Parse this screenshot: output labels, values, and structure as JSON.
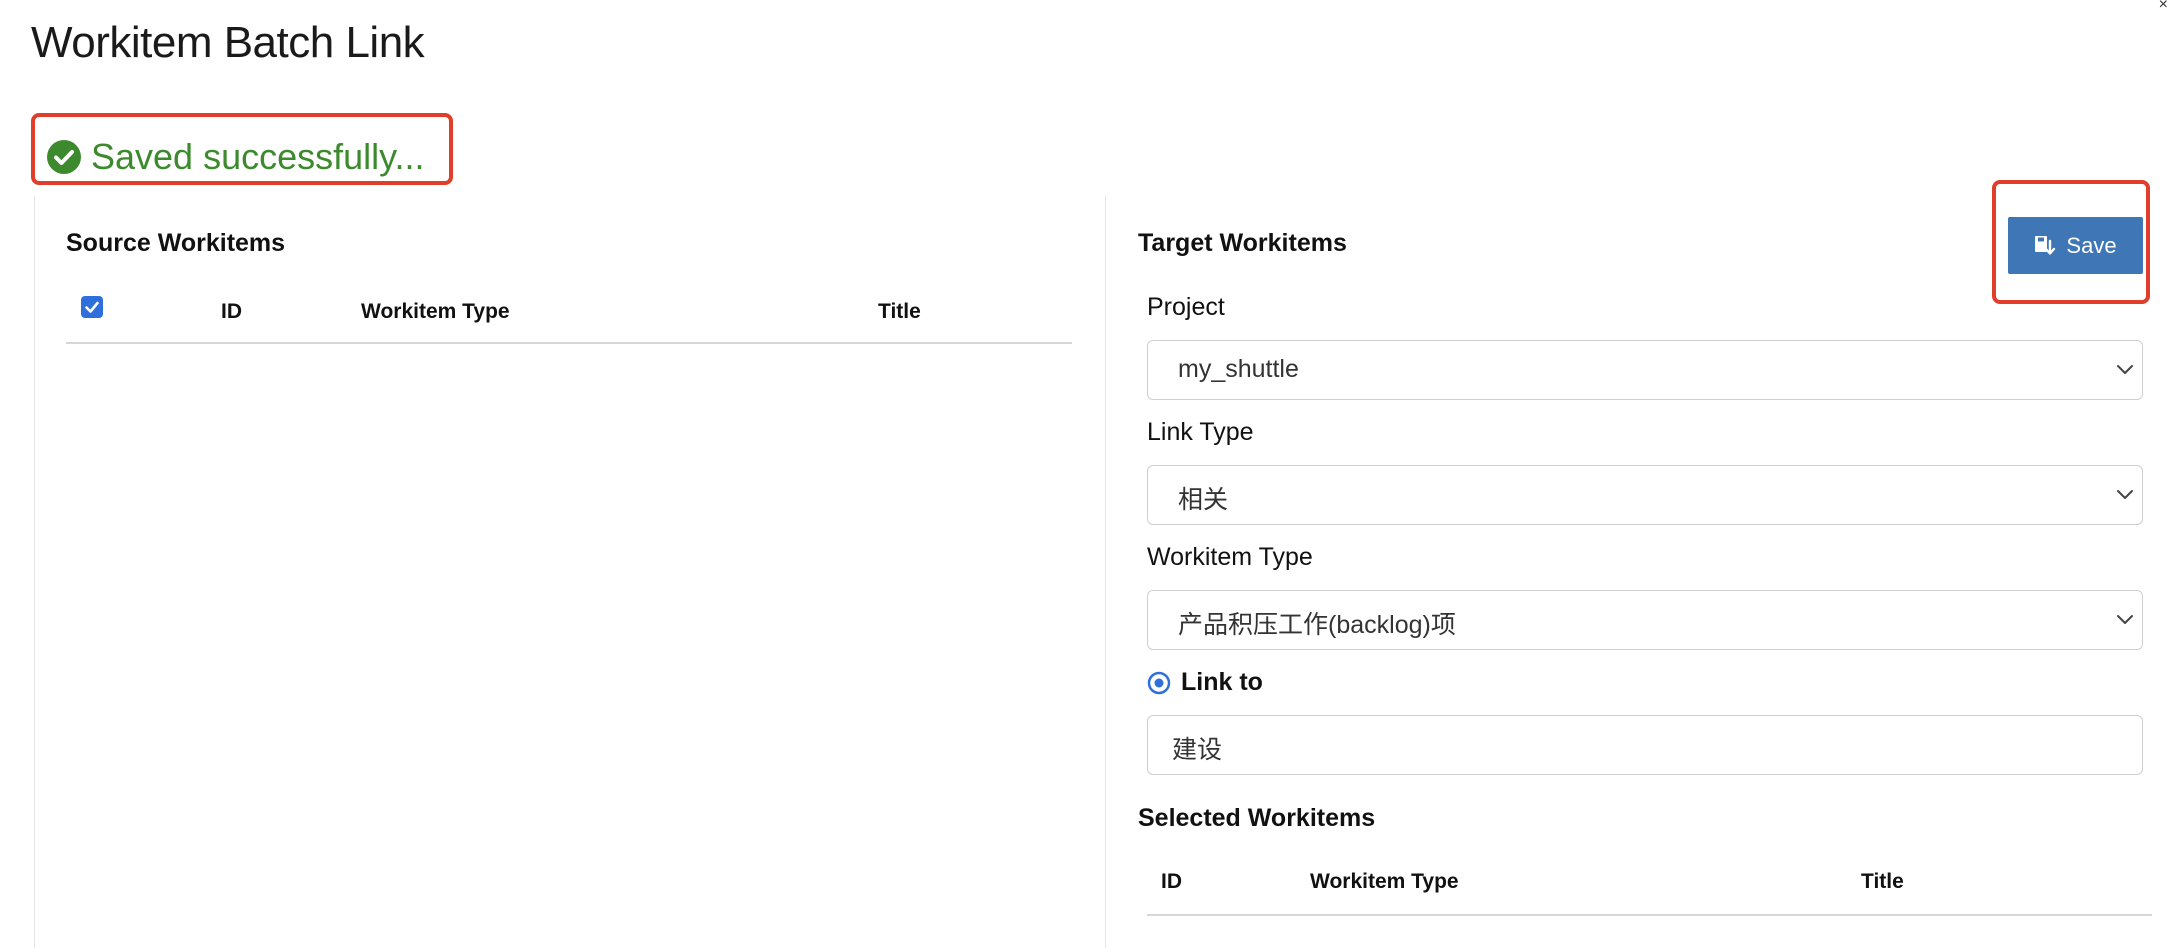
{
  "page": {
    "title": "Workitem Batch Link",
    "corner_mark": "×"
  },
  "status": {
    "message": "Saved successfully...",
    "icon": "check-circle-icon",
    "color": "#3d8a2e"
  },
  "source": {
    "heading": "Source Workitems",
    "select_all_checked": true,
    "columns": [
      "ID",
      "Workitem Type",
      "Title"
    ],
    "rows": []
  },
  "target": {
    "heading": "Target Workitems",
    "save_label": "Save",
    "save_icon": "save-link-icon",
    "project": {
      "label": "Project",
      "value": "my_shuttle"
    },
    "link_type": {
      "label": "Link Type",
      "value": "相关"
    },
    "workitem_type": {
      "label": "Workitem Type",
      "value": "产品积压工作(backlog)项"
    },
    "link_to": {
      "label": "Link to",
      "selected": true,
      "value": "建设"
    }
  },
  "selected": {
    "heading": "Selected Workitems",
    "columns": [
      "ID",
      "Workitem Type",
      "Title"
    ],
    "rows": []
  },
  "colors": {
    "accent": "#3f76b5",
    "highlight": "#e03d2a",
    "checkbox": "#2f6fdb"
  }
}
